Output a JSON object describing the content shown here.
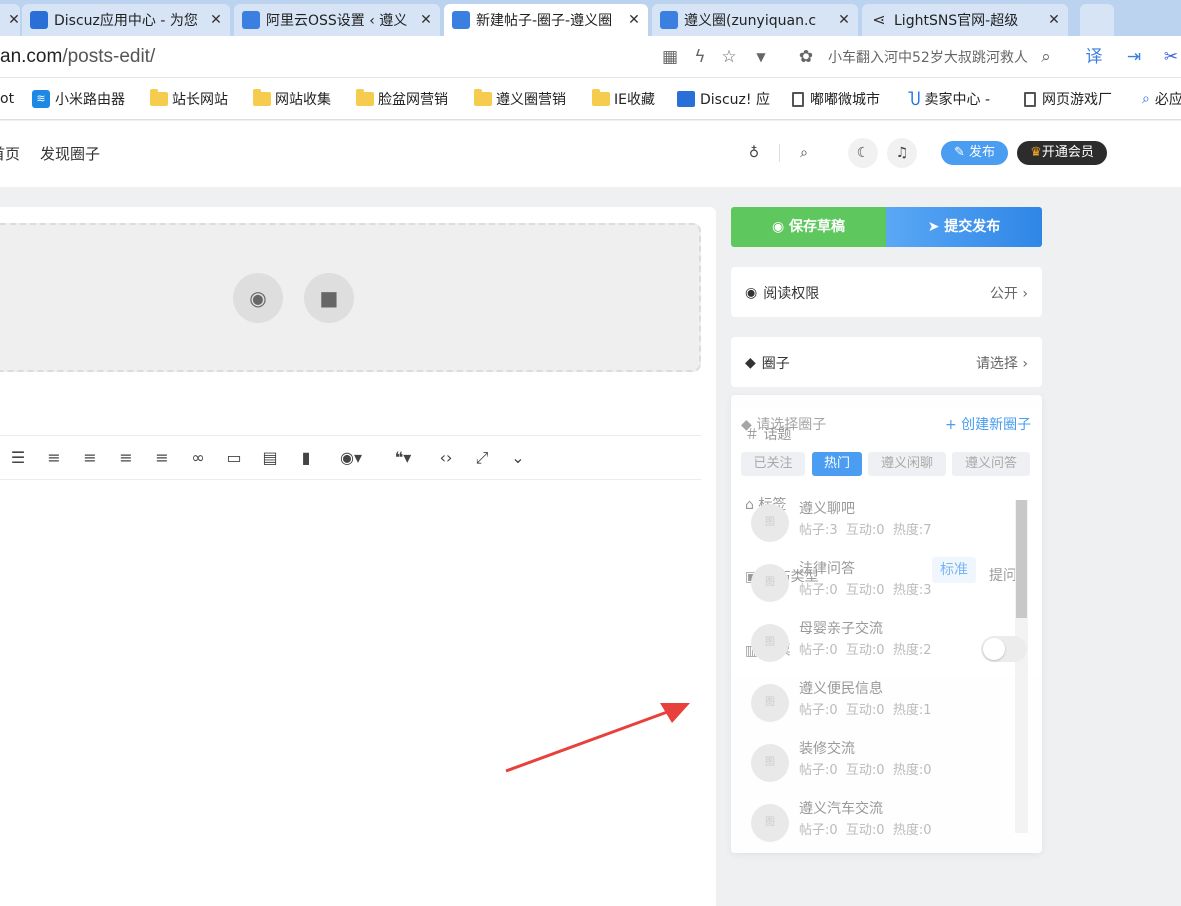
{
  "tabs": [
    {
      "title": "Discuz应用中心 - 为您"
    },
    {
      "title": "阿里云OSS设置 ‹ 遵义"
    },
    {
      "title": "新建帖子-圈子-遵义圈"
    },
    {
      "title": "遵义圈(zunyiquan.c"
    },
    {
      "title": "LightSNS官网-超级"
    }
  ],
  "address": {
    "host": "an.com",
    "path": "/posts-edit/",
    "suggest": "小车翻入河中52岁大叔跳河救人"
  },
  "bookmarks": [
    "ot",
    "小米路由器",
    "站长网站",
    "网站收集",
    "脸盆网营销",
    "遵义圈营销",
    "IE收藏",
    "Discuz! 应",
    "嘟嘟微城市",
    "卖家中心 -",
    "网页游戏厂",
    "必应"
  ],
  "header": {
    "nav": [
      "首页",
      "发现圈子"
    ],
    "publish": "发布",
    "vip": "开通会员"
  },
  "editor": {
    "toolbar_icons": [
      "bullet-list-icon",
      "numbered-list-icon",
      "align-left-icon",
      "align-center-icon",
      "align-right-icon",
      "link-icon",
      "image-icon",
      "video-icon",
      "file-icon",
      "eye-icon",
      "quote-icon",
      "code-icon",
      "fullscreen-icon",
      "chevron-down-icon"
    ]
  },
  "actions": {
    "save_draft": "保存草稿",
    "submit": "提交发布"
  },
  "settings": {
    "read_permission": {
      "label": "阅读权限",
      "value": "公开"
    },
    "circle": {
      "label": "圈子",
      "value": "请选择"
    },
    "topic": "话题",
    "tags": "标签",
    "publish_type": {
      "label": "发布类型",
      "options": [
        "标准",
        "提问"
      ]
    },
    "vote": "投票"
  },
  "circle_picker": {
    "title": "请选择圈子",
    "create": "+ 创建新圈子",
    "filters": [
      "已关注",
      "热门",
      "遵义闲聊",
      "遵义问答"
    ],
    "items": [
      {
        "name": "遵义聊吧",
        "posts": "帖子:3",
        "interact": "互动:0",
        "heat": "热度:7"
      },
      {
        "name": "法律问答",
        "posts": "帖子:0",
        "interact": "互动:0",
        "heat": "热度:3"
      },
      {
        "name": "母婴亲子交流",
        "posts": "帖子:0",
        "interact": "互动:0",
        "heat": "热度:2"
      },
      {
        "name": "遵义便民信息",
        "posts": "帖子:0",
        "interact": "互动:0",
        "heat": "热度:1"
      },
      {
        "name": "装修交流",
        "posts": "帖子:0",
        "interact": "互动:0",
        "heat": "热度:0"
      },
      {
        "name": "遵义汽车交流",
        "posts": "帖子:0",
        "interact": "互动:0",
        "heat": "热度:0"
      }
    ]
  }
}
